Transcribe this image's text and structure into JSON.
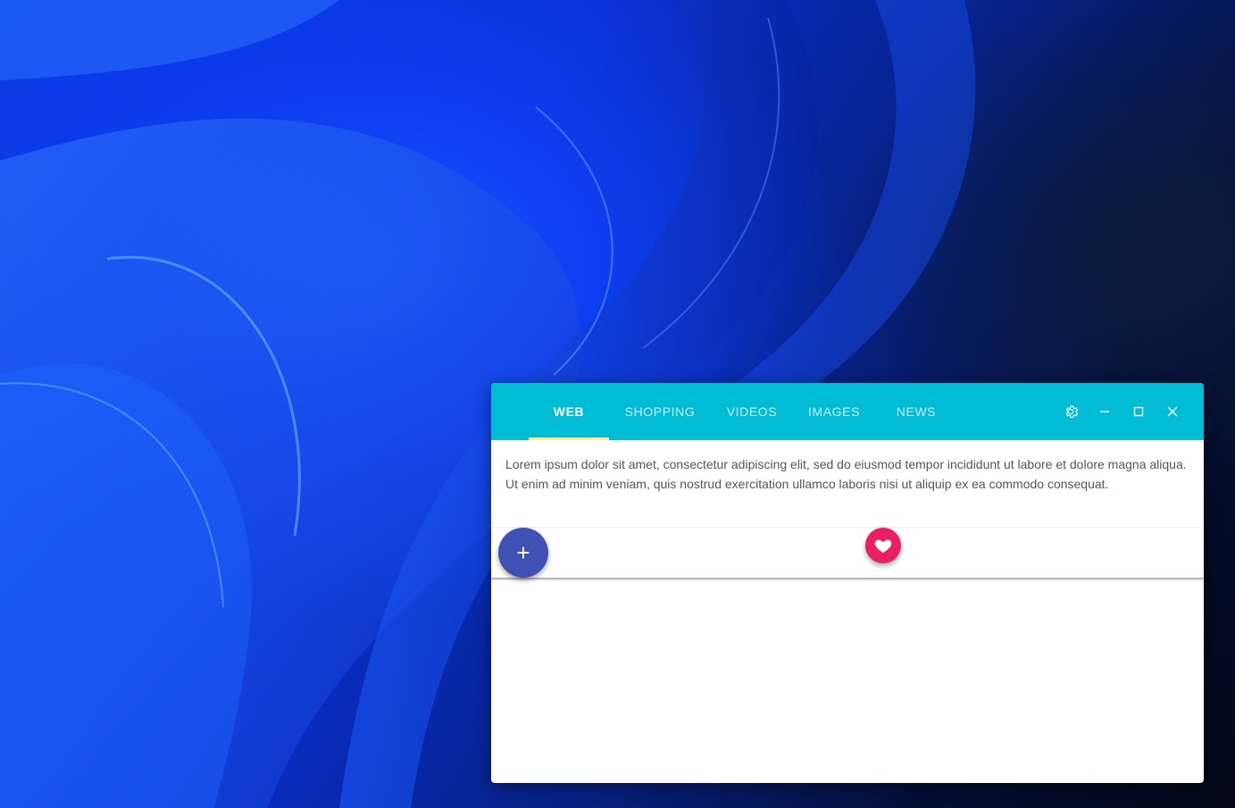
{
  "desktop": {
    "wallpaper": "blue-swirl-wallpaper"
  },
  "window": {
    "tabs": [
      {
        "label": "WEB",
        "active": true
      },
      {
        "label": "SHOPPING",
        "active": false
      },
      {
        "label": "VIDEOS",
        "active": false
      },
      {
        "label": "IMAGES",
        "active": false
      },
      {
        "label": "NEWS",
        "active": false
      }
    ],
    "controls": {
      "settings_icon": "gear-icon",
      "minimize_icon": "minimize-icon",
      "maximize_icon": "maximize-icon",
      "close_icon": "close-icon"
    },
    "content": {
      "text": "Lorem ipsum dolor sit amet, consectetur adipiscing elit, sed do eiusmod tempor incididunt ut labore et dolore magna aliqua. Ut enim ad minim veniam, quis nostrud exercitation ullamco laboris nisi ut aliquip ex ea commodo consequat."
    },
    "buttons": {
      "add_label": "+",
      "add_icon": "plus-icon",
      "favorite_icon": "heart-icon"
    },
    "colors": {
      "titlebar": "#00bcd4",
      "tab_indicator": "#ffeb99",
      "add_button": "#3f51b5",
      "favorite_button": "#e91e63"
    }
  }
}
